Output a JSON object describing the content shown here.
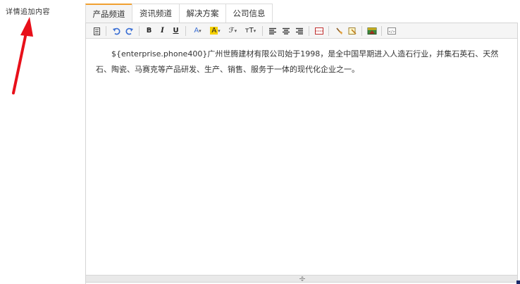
{
  "field": {
    "label": "详情追加内容"
  },
  "tabs": [
    {
      "label": "产品频道",
      "active": true
    },
    {
      "label": "资讯频道",
      "active": false
    },
    {
      "label": "解决方案",
      "active": false
    },
    {
      "label": "公司信息",
      "active": false
    }
  ],
  "toolbar": {
    "buttons": [
      {
        "name": "source-doc-icon"
      },
      {
        "name": "undo-icon"
      },
      {
        "name": "redo-icon"
      },
      {
        "name": "bold-icon",
        "text": "B"
      },
      {
        "name": "italic-icon",
        "text": "I"
      },
      {
        "name": "underline-icon",
        "text": "U"
      },
      {
        "name": "font-color-icon",
        "text": "A"
      },
      {
        "name": "highlight-color-icon",
        "text": "A"
      },
      {
        "name": "font-family-icon",
        "text": "ℱ"
      },
      {
        "name": "font-size-icon",
        "text": "тT"
      },
      {
        "name": "align-left-icon"
      },
      {
        "name": "align-center-icon"
      },
      {
        "name": "align-right-icon"
      },
      {
        "name": "page-break-icon"
      },
      {
        "name": "clear-format-icon"
      },
      {
        "name": "format-painter-icon"
      },
      {
        "name": "insert-image-icon"
      },
      {
        "name": "html-code-icon"
      }
    ]
  },
  "editor": {
    "content": "${enterprise.phone400}广州世腾建材有限公司始于1998，是全中国早期进入人造石行业，并集石英石、天然石、陶瓷、马赛克等产品研发、生产、销售、服务于一体的现代化企业之一。"
  },
  "colors": {
    "accent_tab": "#f0a030",
    "arrow": "#e8101a",
    "undo": "#3b6fd4"
  }
}
